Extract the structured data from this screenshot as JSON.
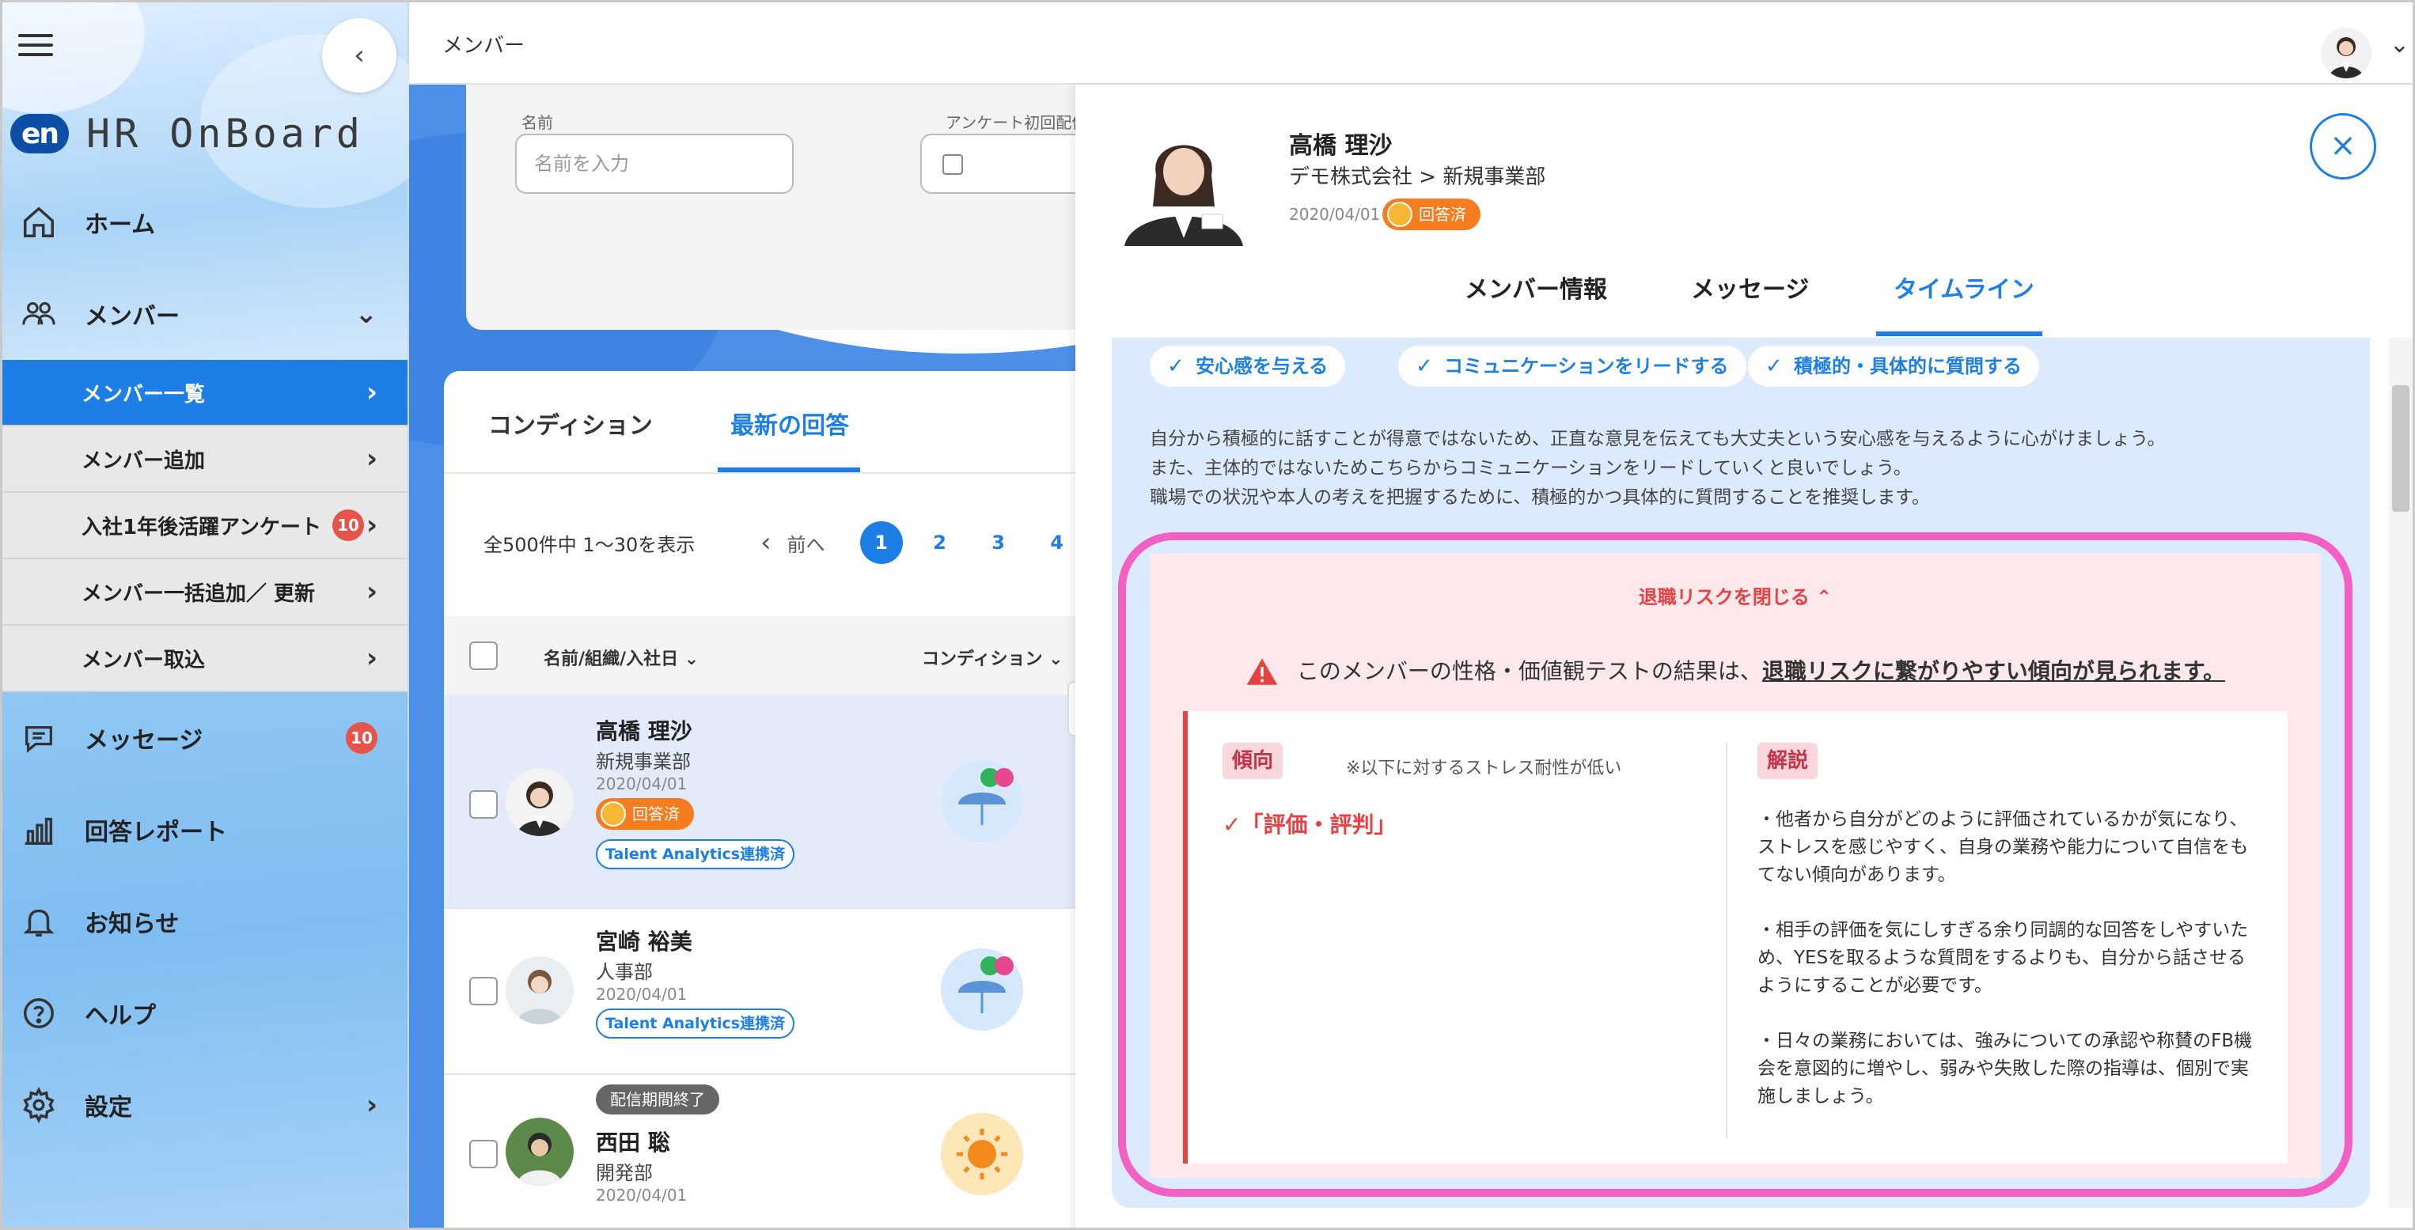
{
  "app": {
    "brand_mark": "en",
    "brand_name": "HR OnBoard"
  },
  "sidebar": {
    "home": "ホーム",
    "members": "メンバー",
    "sub_items": [
      {
        "label": "メンバー一覧",
        "active": true
      },
      {
        "label": "メンバー追加"
      },
      {
        "label": "入社1年後活躍アンケート",
        "badge": "10"
      },
      {
        "label": "メンバー一括追加／ 更新"
      },
      {
        "label": "メンバー取込"
      }
    ],
    "messages": "メッセージ",
    "messages_badge": "10",
    "report": "回答レポート",
    "notice": "お知らせ",
    "help": "ヘルプ",
    "settings": "設定"
  },
  "topbar": {
    "title": "メンバー"
  },
  "filters": {
    "name_label": "名前",
    "name_placeholder": "名前を入力",
    "date_label": "アンケート初回配信"
  },
  "list": {
    "tabs": [
      "コンディション",
      "最新の回答"
    ],
    "summary": "全500件中 1〜30を表示",
    "prev": "前へ",
    "pages": [
      "1",
      "2",
      "3",
      "4"
    ],
    "columns": {
      "name": "名前/組織/入社日",
      "condition": "コンディション"
    },
    "rows": [
      {
        "name": "高橋 理沙",
        "dept": "新規事業部",
        "date": "2020/04/01",
        "status": "回答済",
        "tag": "Talent Analytics連携済"
      },
      {
        "name": "宮崎 裕美",
        "dept": "人事部",
        "date": "2020/04/01",
        "tag": "Talent Analytics連携済"
      },
      {
        "name": "西田 聡",
        "dept": "開発部",
        "date": "2020/04/01",
        "ended": "配信期間終了"
      }
    ]
  },
  "panel": {
    "name": "高橋 理沙",
    "company": "デモ株式会社 > 新規事業部",
    "date": "2020/04/01",
    "status": "回答済",
    "tabs": [
      "メンバー情報",
      "メッセージ",
      "タイムライン"
    ],
    "chips": [
      "安心感を与える",
      "コミュニケーションをリードする",
      "積極的・具体的に質問する"
    ],
    "advice": [
      "自分から積極的に話すことが得意ではないため、正直な意見を伝えても大丈夫という安心感を与えるように心がけましょう。",
      "また、主体的ではないためこちらからコミュニケーションをリードしていくと良いでしょう。",
      "職場での状況や本人の考えを把握するために、積極的かつ具体的に質問することを推奨します。"
    ],
    "risk": {
      "toggle": "退職リスクを閉じる",
      "warning_prefix": "このメンバーの性格・価値観テストの結果は、",
      "warning_emph": "退職リスクに繋がりやすい傾向が見られます。",
      "tendency_label": "傾向",
      "tendency_note": "※以下に対するストレス耐性が低い",
      "tendency_key": "「評価・評判」",
      "explain_label": "解説",
      "explanations": [
        "・他者から自分がどのように評価されているかが気になり、ストレスを感じやすく、自身の業務や能力について自信をもてない傾向があります。",
        "・相手の評価を気にしすぎる余り同調的な回答をしやすいため、YESを取るような質問をするよりも、自分から話させるようにすることが必要です。",
        "・日々の業務においては、強みについての承認や称賛のFB機会を意図的に増やし、弱みや失敗した際の指導は、個別で実施しましょう。"
      ]
    }
  },
  "colors": {
    "accent": "#1d7fe6",
    "risk": "#e84141",
    "highlight_ring": "#f25fc5",
    "badge": "#e5534b",
    "answered": "#f57c1f"
  }
}
